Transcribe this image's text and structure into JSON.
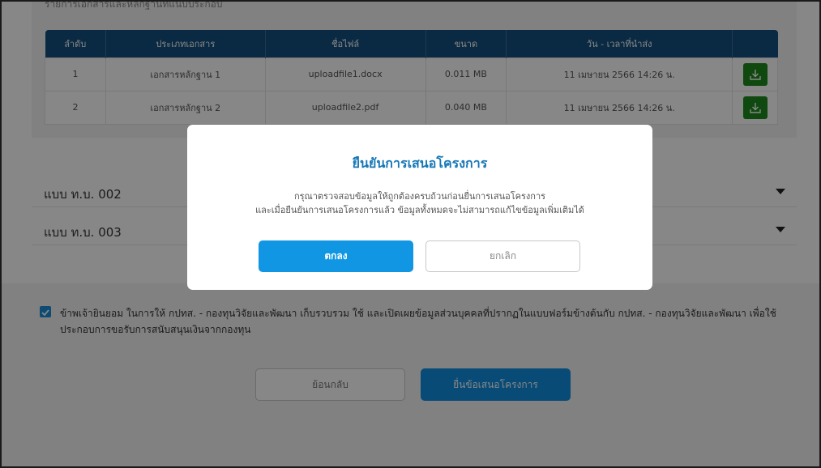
{
  "section": {
    "caption": "รายการเอกสารและหลักฐานที่แนบประกอบ"
  },
  "table": {
    "headers": [
      "ลำดับ",
      "ประเภทเอกสาร",
      "ชื่อไฟล์",
      "ขนาด",
      "วัน - เวลาที่นำส่ง",
      ""
    ],
    "rows": [
      {
        "no": "1",
        "type": "เอกสารหลักฐาน 1",
        "file": "uploadfile1.docx",
        "size": "0.011 MB",
        "date": "11 เมษายน 2566 14:26 น."
      },
      {
        "no": "2",
        "type": "เอกสารหลักฐาน 2",
        "file": "uploadfile2.pdf",
        "size": "0.040 MB",
        "date": "11 เมษายน 2566 14:26 น."
      }
    ]
  },
  "accordion": {
    "items": [
      {
        "label": "แบบ ท.บ. 002"
      },
      {
        "label": "แบบ ท.บ. 003"
      }
    ]
  },
  "consent": {
    "checked": true,
    "text": "ข้าพเจ้ายินยอม ในการให้ กปทส. - กองทุนวิจัยและพัฒนา เก็บรวบรวม ใช้ และเปิดเผยข้อมูลส่วนบุคคลที่ปรากฏในแบบฟอร์มข้างต้นกับ กปทส. - กองทุนวิจัยและพัฒนา เพื่อใช้ประกอบการขอรับการสนับสนุนเงินจากกองทุน"
  },
  "actions": {
    "back_label": "ย้อนกลับ",
    "submit_label": "ยื่นข้อเสนอโครงการ"
  },
  "modal": {
    "title": "ยืนยันการเสนอโครงการ",
    "line1": "กรุณาตรวจสอบข้อมูลให้ถูกต้องครบถ้วนก่อนยื่นการเสนอโครงการ",
    "line2": "และเมื่อยืนยันการเสนอโครงการแล้ว ข้อมูลทั้งหมดจะไม่สามารถแก้ไขข้อมูลเพิ่มเติมได้",
    "ok_label": "ตกลง",
    "cancel_label": "ยกเลิก"
  },
  "colors": {
    "table_header": "#134f7e",
    "download_green": "#1e8a1e",
    "primary_blue": "#1096e2",
    "title_blue": "#1577b7"
  },
  "icons": {
    "download": "download-icon",
    "caret": "caret-down-icon",
    "check": "check-icon"
  }
}
